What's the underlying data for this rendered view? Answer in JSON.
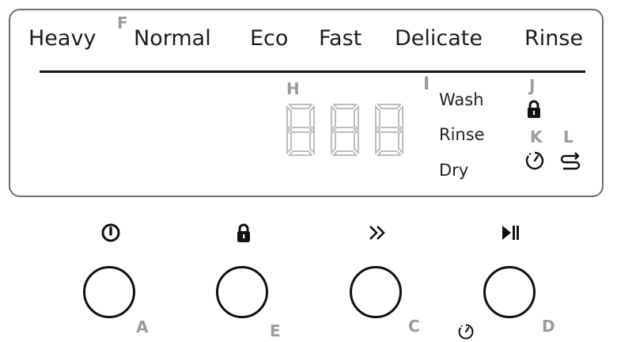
{
  "programs": [
    "Heavy",
    "Normal",
    "Eco",
    "Fast",
    "Delicate",
    "Rinse"
  ],
  "display": {
    "digits": [
      "8",
      "8",
      "8"
    ],
    "cycle_stages": [
      "Wash",
      "Rinse",
      "Dry"
    ]
  },
  "callouts": {
    "F": "F",
    "H": "H",
    "I": "I",
    "J": "J",
    "K": "K",
    "L": "L",
    "A": "A",
    "E": "E",
    "C": "C",
    "D": "D"
  },
  "buttons": [
    {
      "id": "A",
      "icon": "power-icon"
    },
    {
      "id": "E",
      "icon": "lock-icon"
    },
    {
      "id": "C",
      "icon": "double-chevron-right-icon"
    },
    {
      "id": "D",
      "icon": "play-pause-icon"
    }
  ],
  "colors": {
    "callout": "#9c9c9c",
    "segment_off": "#bdbdbd",
    "outline": "#6d6d6d",
    "ink": "#111111"
  }
}
